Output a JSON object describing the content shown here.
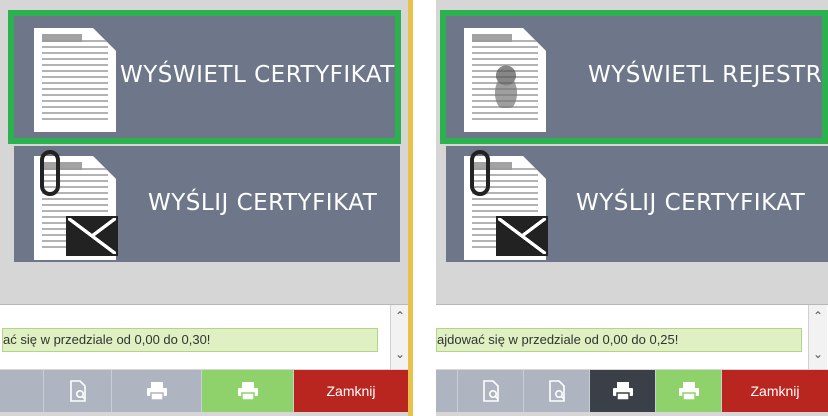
{
  "left_panel": {
    "tiles": [
      {
        "label": "WYŚWIETL CERTYFIKAT",
        "selected": true
      },
      {
        "label": "WYŚLIJ CERTYFIKAT",
        "selected": false
      }
    ],
    "message": "ać się w przedziale od 0,00 do 0,30!",
    "toolbar": {
      "close_label": "Zamknij"
    }
  },
  "right_panel": {
    "tiles": [
      {
        "label": "WYŚWIETL REJESTR",
        "selected": true
      },
      {
        "label": "WYŚLIJ CERTYFIKAT",
        "selected": false
      }
    ],
    "message": "ajdować się w przedziale od 0,00 do 0,25!",
    "toolbar": {
      "close_label": "Zamknij"
    }
  },
  "icons": [
    "document-icon",
    "paperclip-icon",
    "envelope-icon",
    "emblem-icon",
    "scroll-up-icon",
    "scroll-down-icon",
    "print-preview-icon",
    "print-icon"
  ],
  "colors": {
    "tile": "#6d7789",
    "selected_outline": "#2bb14d",
    "message_bg": "#dff0c2",
    "green_button": "#8fd26b",
    "close_button": "#b9261f",
    "gray_button": "#aeb4c0"
  }
}
